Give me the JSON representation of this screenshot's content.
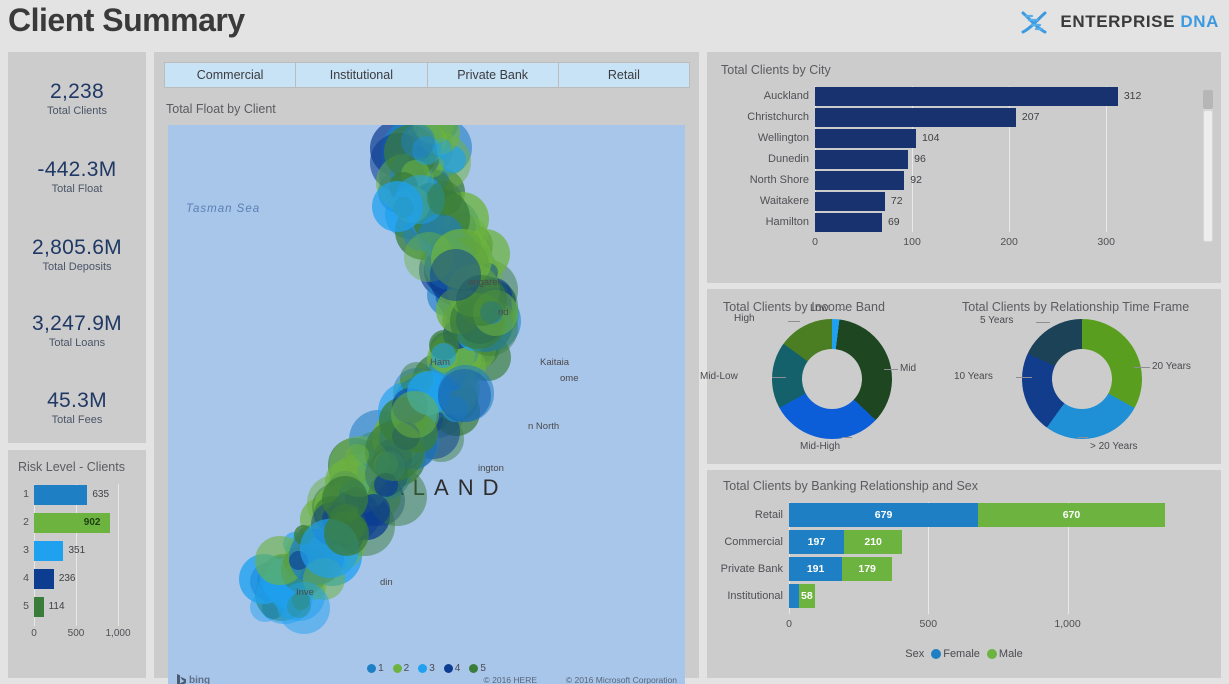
{
  "header": {
    "title": "Client Summary",
    "brand_primary": "ENTERPRISE",
    "brand_secondary": "DNA",
    "logo_icon": "dna-helix-icon"
  },
  "kpis": [
    {
      "value": "2,238",
      "label": "Total Clients"
    },
    {
      "value": "-442.3M",
      "label": "Total Float"
    },
    {
      "value": "2,805.6M",
      "label": "Total Deposits"
    },
    {
      "value": "3,247.9M",
      "label": "Total Loans"
    },
    {
      "value": "45.3M",
      "label": "Total Fees"
    }
  ],
  "tabs": [
    {
      "label": "Commercial"
    },
    {
      "label": "Institutional"
    },
    {
      "label": "Private Bank"
    },
    {
      "label": "Retail"
    }
  ],
  "map": {
    "title": "Total Float by Client",
    "sea_label": "Tasman Sea",
    "country_label": "ZEALAND",
    "cities": [
      "angarei",
      "nd",
      "Kaitaia",
      "ome",
      "Ham",
      "n North",
      "ington",
      "din",
      "Inve"
    ],
    "attribution_here": "© 2016 HERE",
    "attribution_microsoft": "© 2016 Microsoft Corporation",
    "provider": "bing",
    "legend": [
      {
        "label": "1",
        "color": "#1f7fc4"
      },
      {
        "label": "2",
        "color": "#6db33f"
      },
      {
        "label": "3",
        "color": "#1fa1f0"
      },
      {
        "label": "4",
        "color": "#0c3d91"
      },
      {
        "label": "5",
        "color": "#3a7d3a"
      }
    ]
  },
  "chart_data": [
    {
      "type": "bar",
      "title": "Risk Level - Clients",
      "orientation": "horizontal",
      "categories": [
        "1",
        "2",
        "3",
        "4",
        "5"
      ],
      "values": [
        635,
        902,
        351,
        236,
        114
      ],
      "colors": [
        "#1f7fc4",
        "#6db33f",
        "#1fa1f0",
        "#0c3d91",
        "#3a7d3a"
      ],
      "xlabel": "",
      "ylabel": "",
      "xlim": [
        0,
        1000
      ],
      "ticks": [
        "0",
        "500",
        "1,000"
      ],
      "tick_values": [
        0,
        500,
        1000
      ],
      "grid": true
    },
    {
      "type": "bar",
      "title": "Total Clients by City",
      "orientation": "horizontal",
      "categories": [
        "Auckland",
        "Christchurch",
        "Wellington",
        "Dunedin",
        "North Shore",
        "Waitakere",
        "Hamilton"
      ],
      "values": [
        312,
        207,
        104,
        96,
        92,
        72,
        69
      ],
      "color": "#17326e",
      "xlim": [
        0,
        340
      ],
      "ticks": [
        "0",
        "100",
        "200",
        "300"
      ],
      "tick_values": [
        0,
        100,
        200,
        300
      ],
      "grid": true,
      "scrollbar": true
    },
    {
      "type": "pie",
      "title": "Total Clients by Income Band",
      "labels": [
        "Low",
        "Mid",
        "Mid-High",
        "Mid-Low",
        "High"
      ],
      "values": [
        2,
        35,
        30,
        18,
        15
      ],
      "colors": [
        "#1fa1f0",
        "#1e4620",
        "#0b5ed7",
        "#14616b",
        "#4b7d22"
      ],
      "donut": true,
      "legend_position": "callout-labels"
    },
    {
      "type": "pie",
      "title": "Total Clients by Relationship Time Frame",
      "labels": [
        "20 Years",
        "> 20 Years",
        "10 Years",
        "5 Years"
      ],
      "values": [
        33,
        27,
        22,
        18
      ],
      "colors": [
        "#5a9e1f",
        "#1f8fd6",
        "#123c8c",
        "#1c4257"
      ],
      "donut": true,
      "legend_position": "callout-labels"
    },
    {
      "type": "bar",
      "title": "Total Clients by Banking Relationship and Sex",
      "orientation": "horizontal",
      "stacked": true,
      "categories": [
        "Retail",
        "Commercial",
        "Private Bank",
        "Institutional"
      ],
      "series": [
        {
          "name": "Female",
          "color": "#1f7fc4",
          "values": [
            679,
            197,
            191,
            35
          ]
        },
        {
          "name": "Male",
          "color": "#6db33f",
          "values": [
            670,
            210,
            179,
            58
          ]
        }
      ],
      "value_labels": {
        "Retail": [
          "679",
          "670"
        ],
        "Commercial": [
          "197",
          "210"
        ],
        "Private Bank": [
          "191",
          "179"
        ],
        "Institutional": [
          "",
          "58"
        ]
      },
      "xlim": [
        0,
        1400
      ],
      "ticks": [
        "0",
        "500",
        "1,000"
      ],
      "tick_values": [
        0,
        500,
        1000
      ],
      "legend_title": "Sex",
      "legend_position": "bottom",
      "grid": true
    }
  ]
}
